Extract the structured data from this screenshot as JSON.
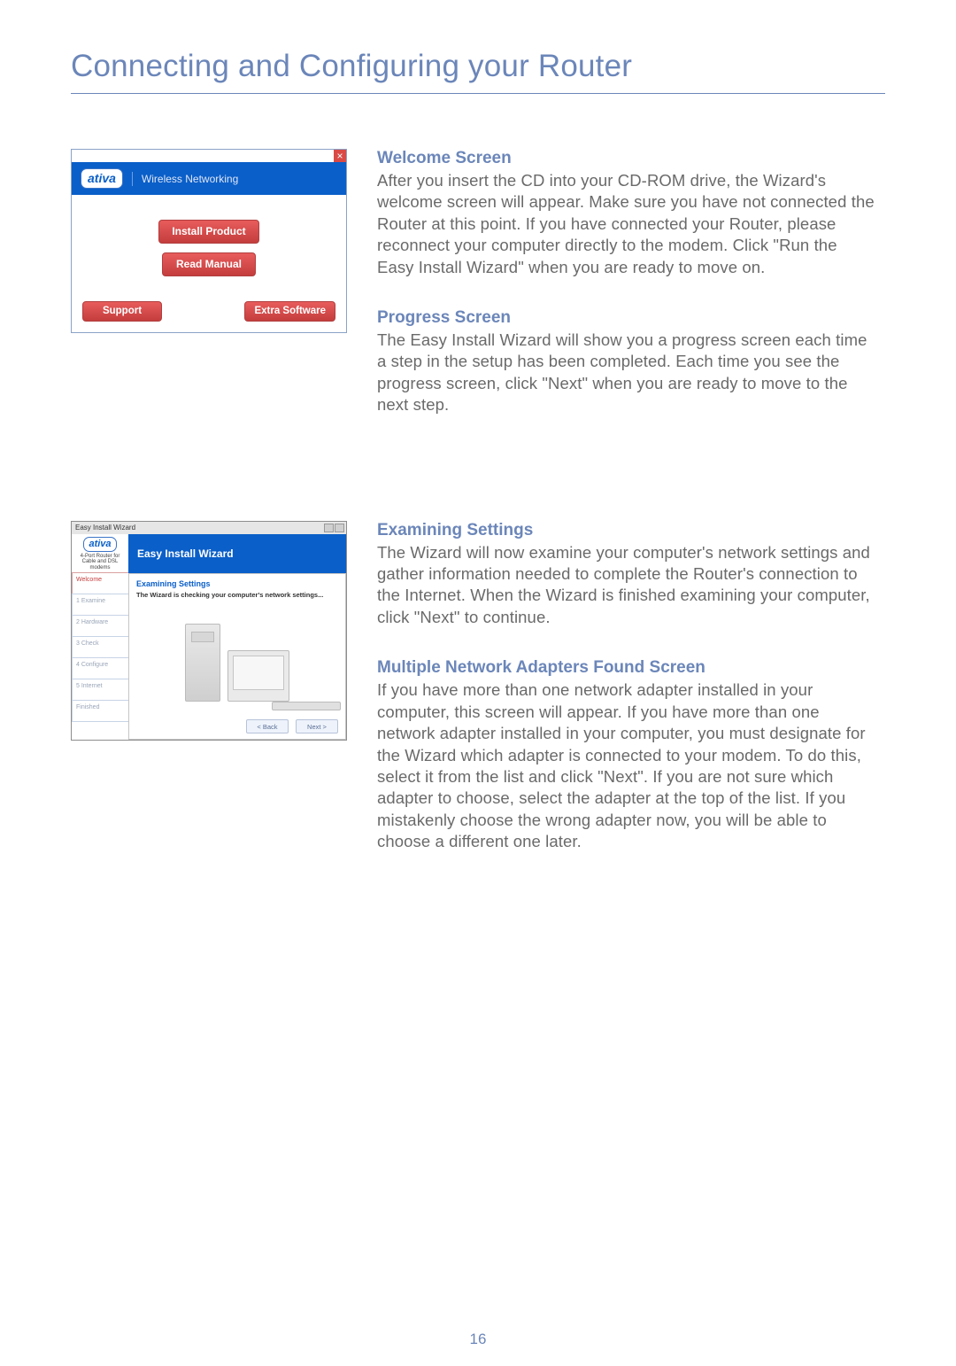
{
  "page": {
    "title": "Connecting and Configuring your Router",
    "number": "16"
  },
  "sections": [
    {
      "heading": "Welcome Screen",
      "body": "After you insert the CD into your CD-ROM drive, the Wizard's welcome screen will appear. Make sure you have not connected the Router at this point. If you have connected your Router, please reconnect your computer directly to the modem. Click \"Run the Easy Install Wizard\" when you are ready to move on."
    },
    {
      "heading": "Progress Screen",
      "body": "The Easy Install Wizard will show you a progress screen each time a step in the setup has been completed. Each time you see the progress screen, click \"Next\" when you are ready to move to the next step."
    },
    {
      "heading": "Examining Settings",
      "body": "The Wizard will now examine your computer's network settings and gather information needed to complete the Router's connection to the Internet. When the Wizard is finished examining your computer, click \"Next\" to continue."
    },
    {
      "heading": "Multiple Network Adapters Found Screen",
      "body": "If you have more than one network adapter installed in your computer, this screen will appear. If you have more than one network adapter installed in your computer, you must designate for the Wizard which adapter is connected to your modem. To do this, select it from the list and click \"Next\". If you are not sure which adapter to choose, select the adapter at the top of the list. If you mistakenly choose the wrong adapter now, you will be able to choose a different one later."
    }
  ],
  "shot1": {
    "logo": "ativa",
    "subtitle": "Wireless Networking",
    "btn_install": "Install Product",
    "btn_manual": "Read Manual",
    "btn_support": "Support",
    "btn_extra": "Extra Software"
  },
  "shot2": {
    "titlebar": "Easy Install Wizard",
    "logo": "ativa",
    "product_sub": "4-Port Router for Cable and DSL modems",
    "wizard_label": "Easy Install Wizard",
    "steps": [
      "Welcome",
      "1 Examine",
      "2 Hardware",
      "3 Check",
      "4 Configure",
      "5 Internet",
      "Finished"
    ],
    "content_heading": "Examining Settings",
    "content_msg": "The Wizard is checking your computer's network settings...",
    "btn_back": "< Back",
    "btn_next": "Next >"
  }
}
